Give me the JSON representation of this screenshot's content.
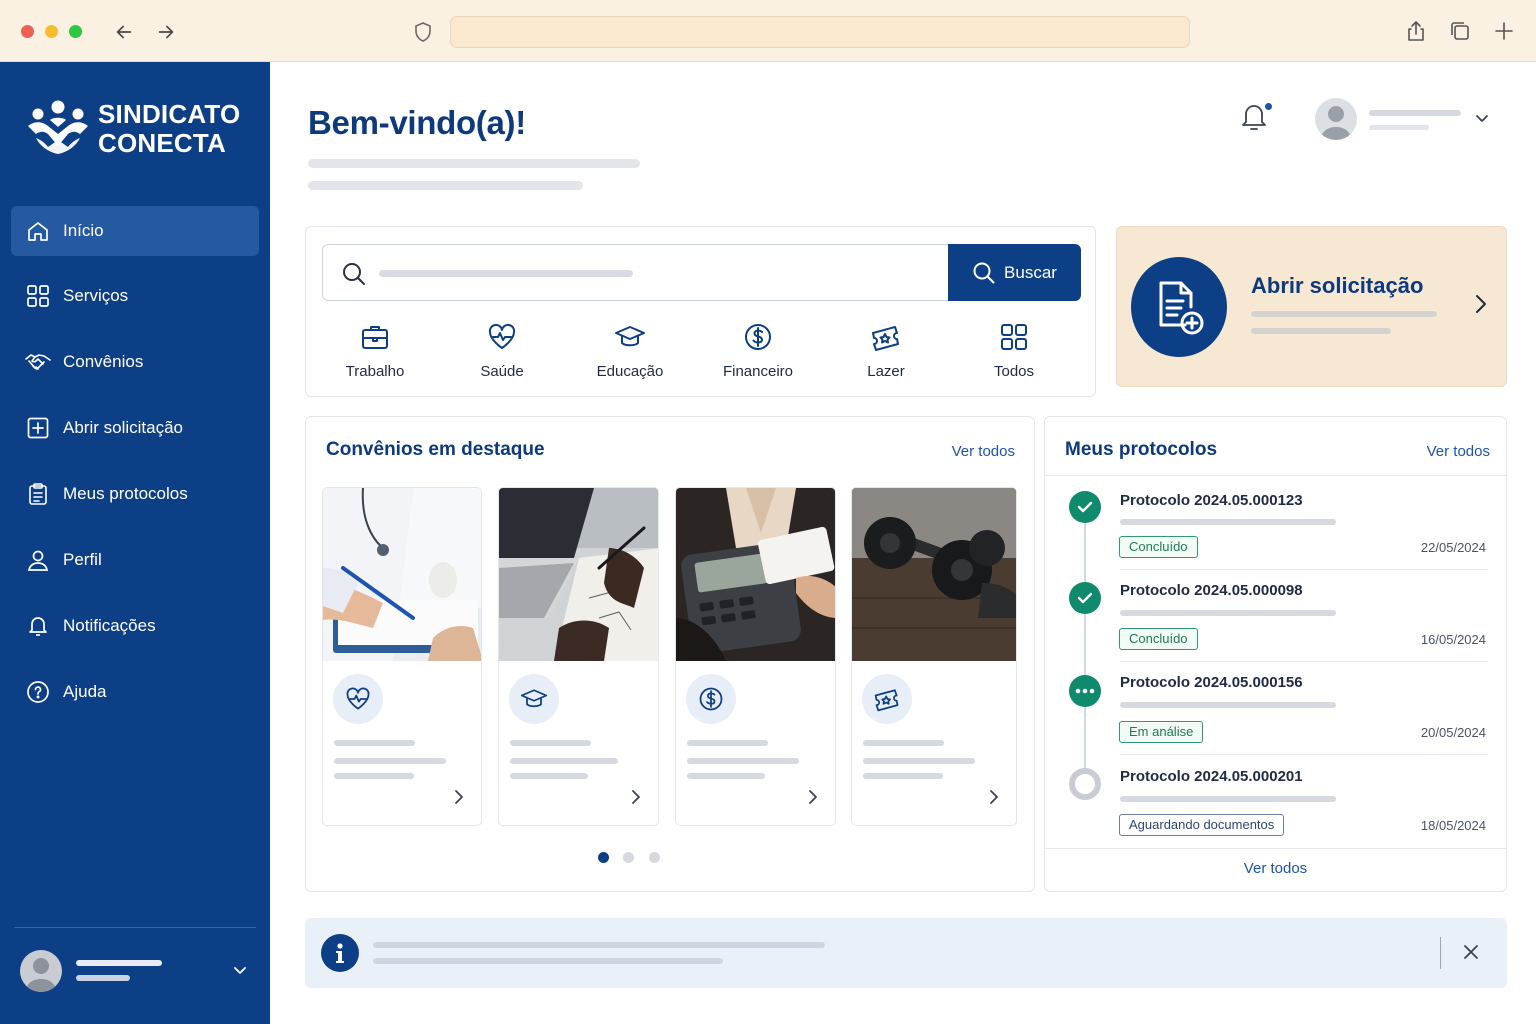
{
  "colors": {
    "primary": "#0d3f86",
    "accent": "#1a54b0",
    "success": "#0f8a6d",
    "warm": "#f6e8d2"
  },
  "chrome": {
    "icons": [
      "back-arrow-icon",
      "forward-arrow-icon",
      "shield-icon",
      "share-icon",
      "tabs-icon",
      "plus-icon"
    ]
  },
  "sidebar": {
    "brand_line1": "SINDICATO",
    "brand_line2": "CONECTA",
    "items": [
      {
        "label": "Início",
        "icon": "home-icon",
        "active": true
      },
      {
        "label": "Serviços",
        "icon": "grid-icon"
      },
      {
        "label": "Convênios",
        "icon": "handshake-icon"
      },
      {
        "label": "Abrir solicitação",
        "icon": "plus-square-icon"
      },
      {
        "label": "Meus protocolos",
        "icon": "clipboard-icon"
      },
      {
        "label": "Perfil",
        "icon": "user-icon"
      },
      {
        "label": "Notificações",
        "icon": "bell-icon"
      },
      {
        "label": "Ajuda",
        "icon": "help-icon"
      }
    ]
  },
  "header": {
    "title": "Bem-vindo(a)!"
  },
  "search": {
    "button_label": "Buscar",
    "categories": [
      {
        "label": "Trabalho",
        "icon": "briefcase-icon"
      },
      {
        "label": "Saúde",
        "icon": "heart-pulse-icon"
      },
      {
        "label": "Educação",
        "icon": "graduation-cap-icon"
      },
      {
        "label": "Financeiro",
        "icon": "dollar-icon"
      },
      {
        "label": "Lazer",
        "icon": "ticket-icon"
      },
      {
        "label": "Todos",
        "icon": "grid-icon"
      }
    ]
  },
  "open_request": {
    "title": "Abrir solicitação",
    "icon": "file-plus-icon"
  },
  "convenios": {
    "title": "Convênios em destaque",
    "see_all": "Ver todos",
    "cards": [
      {
        "icon": "heart-pulse-icon",
        "image": "doctor-clipboard"
      },
      {
        "icon": "graduation-cap-icon",
        "image": "laptop-writing"
      },
      {
        "icon": "dollar-icon",
        "image": "card-terminal"
      },
      {
        "icon": "ticket-icon",
        "image": "dumbbells"
      }
    ],
    "pager": {
      "pages": 3,
      "current": 1
    }
  },
  "protocols": {
    "title": "Meus protocolos",
    "see_all_top": "Ver todos",
    "see_all_bottom": "Ver todos",
    "items": [
      {
        "name": "Protocolo 2024.05.000123",
        "status": "Concluído",
        "status_type": "done",
        "date": "22/05/2024"
      },
      {
        "name": "Protocolo 2024.05.000098",
        "status": "Concluído",
        "status_type": "done",
        "date": "16/05/2024"
      },
      {
        "name": "Protocolo 2024.05.000156",
        "status": "Em análise",
        "status_type": "progress",
        "date": "20/05/2024"
      },
      {
        "name": "Protocolo 2024.05.000201",
        "status": "Aguardando documentos",
        "status_type": "waiting",
        "date": "18/05/2024"
      }
    ]
  },
  "banner": {
    "icon": "info-icon"
  }
}
